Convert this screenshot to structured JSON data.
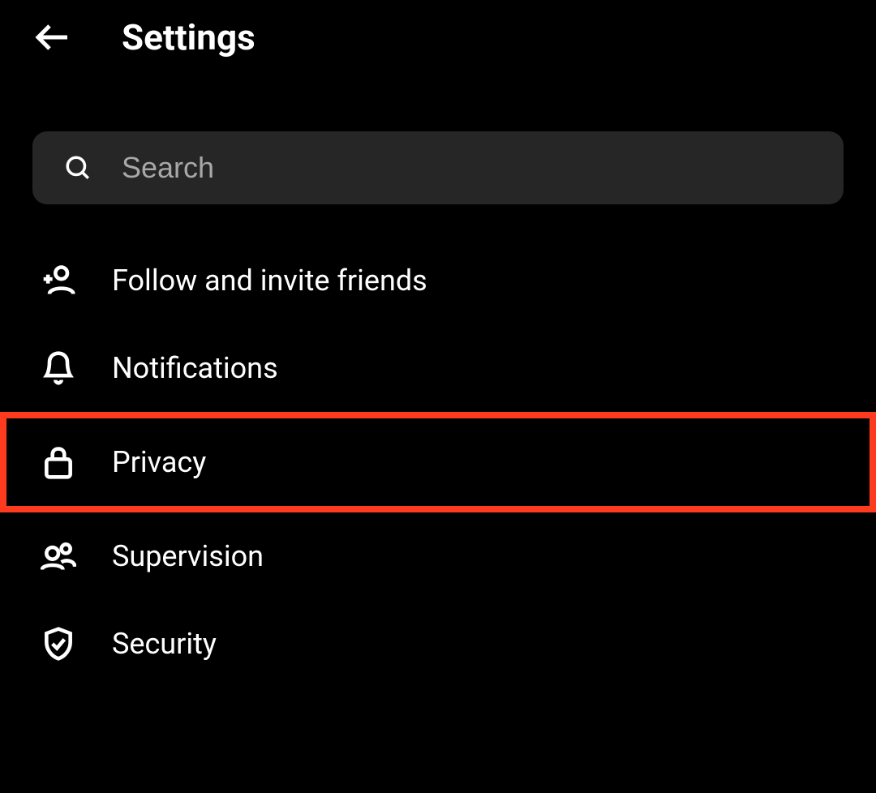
{
  "header": {
    "title": "Settings"
  },
  "search": {
    "placeholder": "Search"
  },
  "menu": {
    "items": [
      {
        "label": "Follow and invite friends"
      },
      {
        "label": "Notifications"
      },
      {
        "label": "Privacy"
      },
      {
        "label": "Supervision"
      },
      {
        "label": "Security"
      }
    ]
  }
}
